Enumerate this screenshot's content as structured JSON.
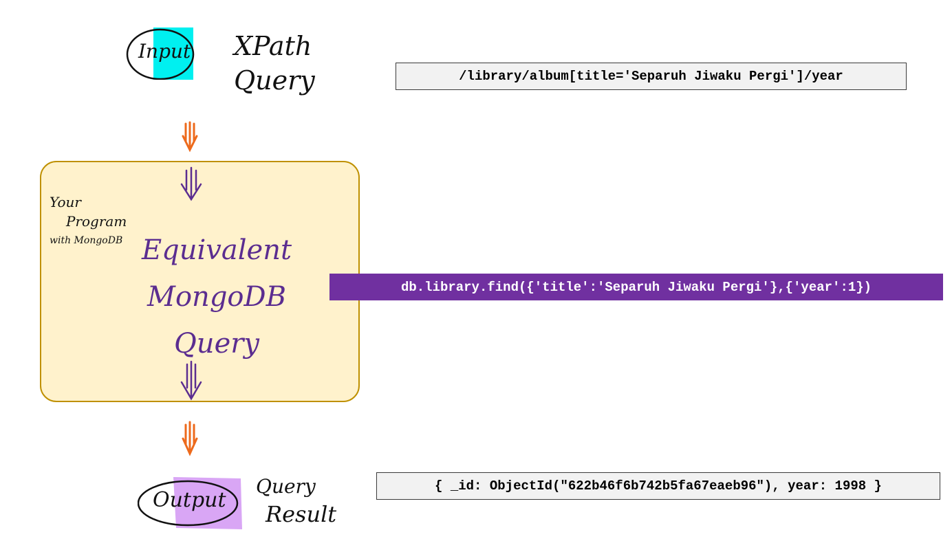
{
  "input_label": "Input",
  "xpath_label": "XPath Query",
  "xpath_query": "/library/album[title='Separuh Jiwaku Pergi']/year",
  "program": {
    "note_line1": "Your",
    "note_line2": "Program",
    "note_line3": "with MongoDB",
    "title_line1": "Equivalent",
    "title_line2": "MongoDB Query"
  },
  "mongo_query": "db.library.find({'title':'Separuh Jiwaku Pergi'},{'year':1})",
  "output_label": "Output",
  "result_label_line1": "Query",
  "result_label_line2": "Result",
  "query_result": "{ _id: ObjectId(\"622b46f6b742b5fa67eaeb96\"), year: 1998 }",
  "colors": {
    "input_highlight": "#00f0f0",
    "output_highlight": "#d9a6f5",
    "outer_arrow": "#ed6a1c",
    "inner_arrow": "#5b2d90",
    "mongo_box": "#7030a0",
    "panel_fill": "#fff2cc",
    "panel_border": "#bf9000"
  }
}
